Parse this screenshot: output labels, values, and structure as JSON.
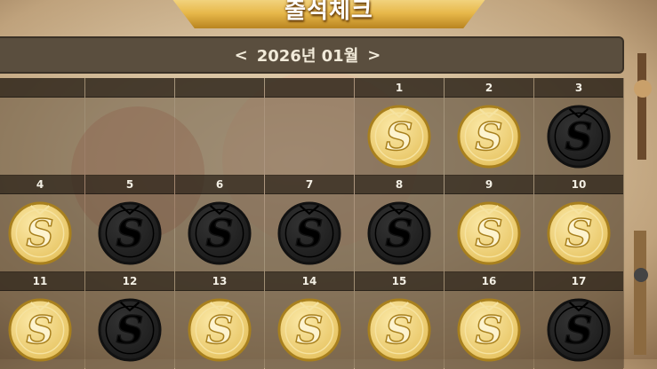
{
  "title": "출석체크",
  "month": {
    "prev_label": "<",
    "label": "2026년 01월",
    "next_label": ">"
  },
  "days": [
    {
      "day": "",
      "status": "empty"
    },
    {
      "day": "",
      "status": "empty"
    },
    {
      "day": "",
      "status": "empty"
    },
    {
      "day": "",
      "status": "empty"
    },
    {
      "day": "1",
      "status": "checked"
    },
    {
      "day": "2",
      "status": "checked"
    },
    {
      "day": "3",
      "status": "unchecked"
    },
    {
      "day": "4",
      "status": "checked"
    },
    {
      "day": "5",
      "status": "unchecked"
    },
    {
      "day": "6",
      "status": "unchecked"
    },
    {
      "day": "7",
      "status": "unchecked"
    },
    {
      "day": "8",
      "status": "unchecked"
    },
    {
      "day": "9",
      "status": "checked"
    },
    {
      "day": "10",
      "status": "checked"
    },
    {
      "day": "11",
      "status": "checked"
    },
    {
      "day": "12",
      "status": "unchecked"
    },
    {
      "day": "13",
      "status": "checked"
    },
    {
      "day": "14",
      "status": "checked"
    },
    {
      "day": "15",
      "status": "checked"
    },
    {
      "day": "16",
      "status": "checked"
    },
    {
      "day": "17",
      "status": "unchecked"
    }
  ],
  "colors": {
    "gold": "#e6c25e",
    "gold_dark": "#a8801e",
    "black_coin": "#111111",
    "header_bg": "#2d2319"
  },
  "icons": {
    "checked": "gold-s-coin-icon",
    "unchecked": "black-s-coin-icon"
  }
}
